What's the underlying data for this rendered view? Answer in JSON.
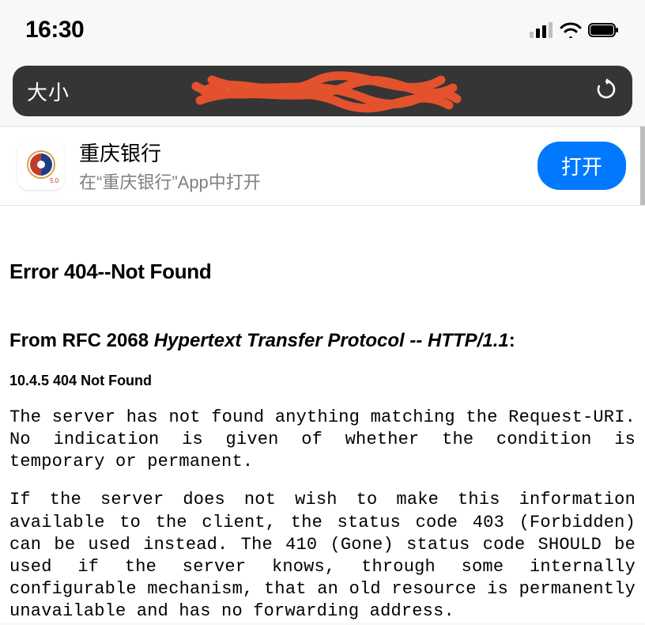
{
  "status": {
    "time": "16:30"
  },
  "address_bar": {
    "text_size_button": "大小"
  },
  "app_banner": {
    "name": "重庆银行",
    "subtitle": "在“重庆银行”App中打开",
    "open_label": "打开"
  },
  "error": {
    "title": "Error 404--Not Found",
    "rfc_prefix": "From RFC 2068 ",
    "rfc_italic": "Hypertext Transfer Protocol -- HTTP/1.1",
    "rfc_suffix": ":",
    "section": "10.4.5 404 Not Found",
    "para1": "The server has not found anything matching the Request-URI. No indication is given of whether the condition is temporary or permanent.",
    "para2": "If the server does not wish to make this information available to the client, the status code 403 (Forbidden) can be used instead. The 410 (Gone) status code SHOULD be used if the server knows, through some internally configurable mechanism, that an old resource is permanently unavailable and has no forwarding address."
  }
}
